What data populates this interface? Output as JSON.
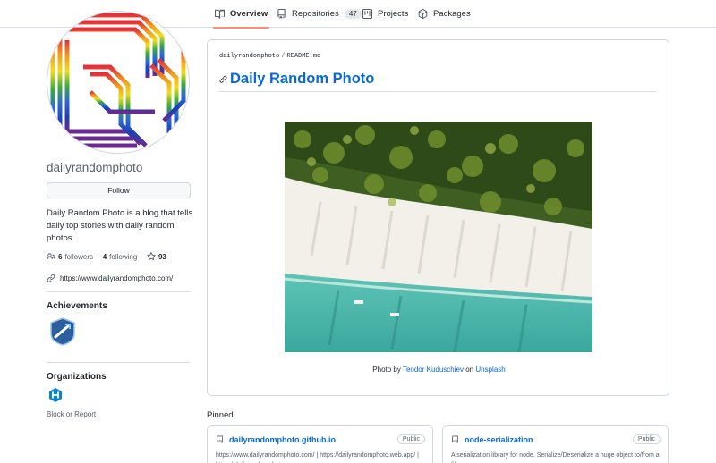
{
  "tabs": [
    {
      "label": "Overview",
      "icon": "book-icon",
      "selected": true
    },
    {
      "label": "Repositories",
      "icon": "repo-icon",
      "count": "47"
    },
    {
      "label": "Projects",
      "icon": "project-icon"
    },
    {
      "label": "Packages",
      "icon": "package-icon"
    }
  ],
  "profile": {
    "username": "dailyrandomphoto",
    "follow_label": "Follow",
    "bio": "Daily Random Photo is a blog that tells daily top stories with daily random photos.",
    "followers_count": "6",
    "followers_label": "followers",
    "following_count": "4",
    "following_label": "following",
    "stars_count": "93",
    "dot": "·",
    "website": "https://www.dailyrandomphoto.com/"
  },
  "sidebar": {
    "achievements_title": "Achievements",
    "organizations_title": "Organizations",
    "block_label": "Block or Report"
  },
  "readme": {
    "path_user": "dailyrandomphoto",
    "path_sep": "/",
    "path_file": "README.md",
    "heading": "Daily Random Photo",
    "caption_prefix": "Photo by",
    "caption_author": "Teodor Kuduschiev",
    "caption_mid": "on",
    "caption_site": "Unsplash"
  },
  "pinned": {
    "title": "Pinned",
    "cards": [
      {
        "name": "dailyrandomphoto.github.io",
        "visibility": "Public",
        "description": "https://www.dailyrandomphoto.com/ | https://dailyrandomphoto.web.app/ | https://dailyrandomphoto.now.sh"
      },
      {
        "name": "node-serialization",
        "visibility": "Public",
        "description": "A serialization library for node. Serialize/Deserialize a huge object to/from a file."
      }
    ]
  },
  "colors": {
    "accent": "#0969da",
    "tab_underline": "#fd8c73",
    "border": "#d0d7de",
    "muted": "#57606a"
  }
}
